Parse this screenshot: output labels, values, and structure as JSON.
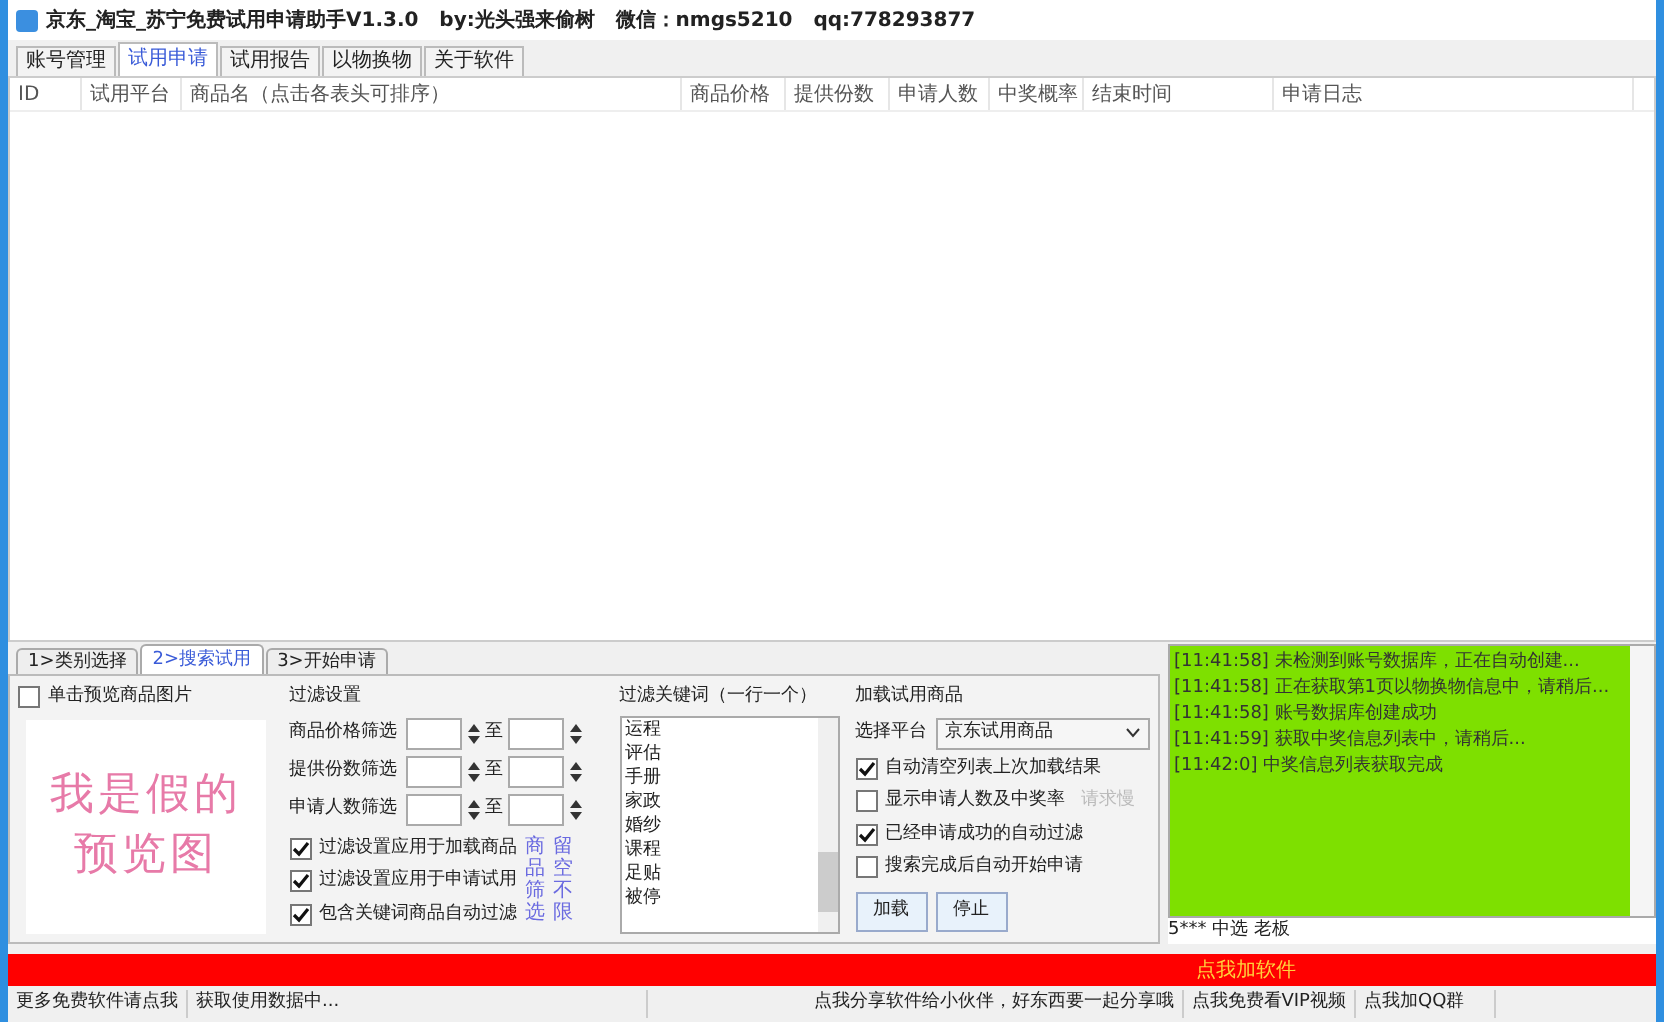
{
  "window": {
    "title": "京东_淘宝_苏宁免费试用申请助手V1.3.0   by:光头强来偷树   微信：nmgs5210   qq:778293877"
  },
  "tabs": [
    {
      "label": "账号管理",
      "selected": false
    },
    {
      "label": "试用申请",
      "selected": true
    },
    {
      "label": "试用报告",
      "selected": false
    },
    {
      "label": "以物换物",
      "selected": false
    },
    {
      "label": "关于软件",
      "selected": false
    }
  ],
  "table": {
    "columns": [
      "ID",
      "试用平台",
      "商品名（点击各表头可排序）",
      "商品价格",
      "提供份数",
      "申请人数",
      "中奖概率",
      "结束时间",
      "申请日志"
    ]
  },
  "steps": [
    {
      "label": "1>类别选择",
      "selected": false
    },
    {
      "label": "2>搜索试用",
      "selected": true
    },
    {
      "label": "3>开始申请",
      "selected": false
    }
  ],
  "preview": {
    "checkbox": {
      "label": "单击预览商品图片",
      "checked": false
    },
    "text_lines": [
      "我是假的",
      "预览图"
    ]
  },
  "filter": {
    "title": "过滤设置",
    "ranges": [
      {
        "label": "商品价格筛选",
        "to": "至"
      },
      {
        "label": "提供份数筛选",
        "to": "至"
      },
      {
        "label": "申请人数筛选",
        "to": "至"
      }
    ],
    "options": [
      {
        "label": "过滤设置应用于加载商品",
        "checked": true
      },
      {
        "label": "过滤设置应用于申请试用",
        "checked": true
      },
      {
        "label": "包含关键词商品自动过滤",
        "checked": true
      }
    ],
    "note_columns": [
      "商品筛选",
      "留空不限"
    ]
  },
  "keywords": {
    "title": "过滤关键词（一行一个）",
    "items": [
      "运程",
      "评估",
      "手册",
      "家政",
      "婚纱",
      "课程",
      "足贴",
      "被停"
    ]
  },
  "load": {
    "title": "加载试用商品",
    "platform_label": "选择平台",
    "platform": "京东试用商品",
    "options": [
      {
        "label": "自动清空列表上次加载结果",
        "checked": true
      },
      {
        "label": "显示申请人数及中奖率",
        "checked": false,
        "hint": {
          "label": "请求慢",
          "disabled": true
        }
      },
      {
        "label": "已经申请成功的自动过滤",
        "checked": true
      },
      {
        "label": "搜索完成后自动开始申请",
        "checked": false
      }
    ],
    "buttons": [
      "加载",
      "停止"
    ]
  },
  "log": {
    "lines": [
      "[11:41:58] 未检测到账号数据库，正在自动创建...",
      "[11:41:58] 正在获取第1页以物换物信息中，请稍后...",
      "[11:41:58] 账号数据库创建成功",
      "[11:41:59] 获取中奖信息列表中，请稍后...",
      "[11:42:0] 中奖信息列表获取完成"
    ],
    "footer": "5*** 中选 老板"
  },
  "banner": "点我加软件",
  "status_bar": [
    "更多免费软件请点我",
    "获取使用数据中...",
    "点我分享软件给小伙伴，好东西要一起分享哦",
    "点我免费看VIP视频",
    "点我加QQ群"
  ]
}
